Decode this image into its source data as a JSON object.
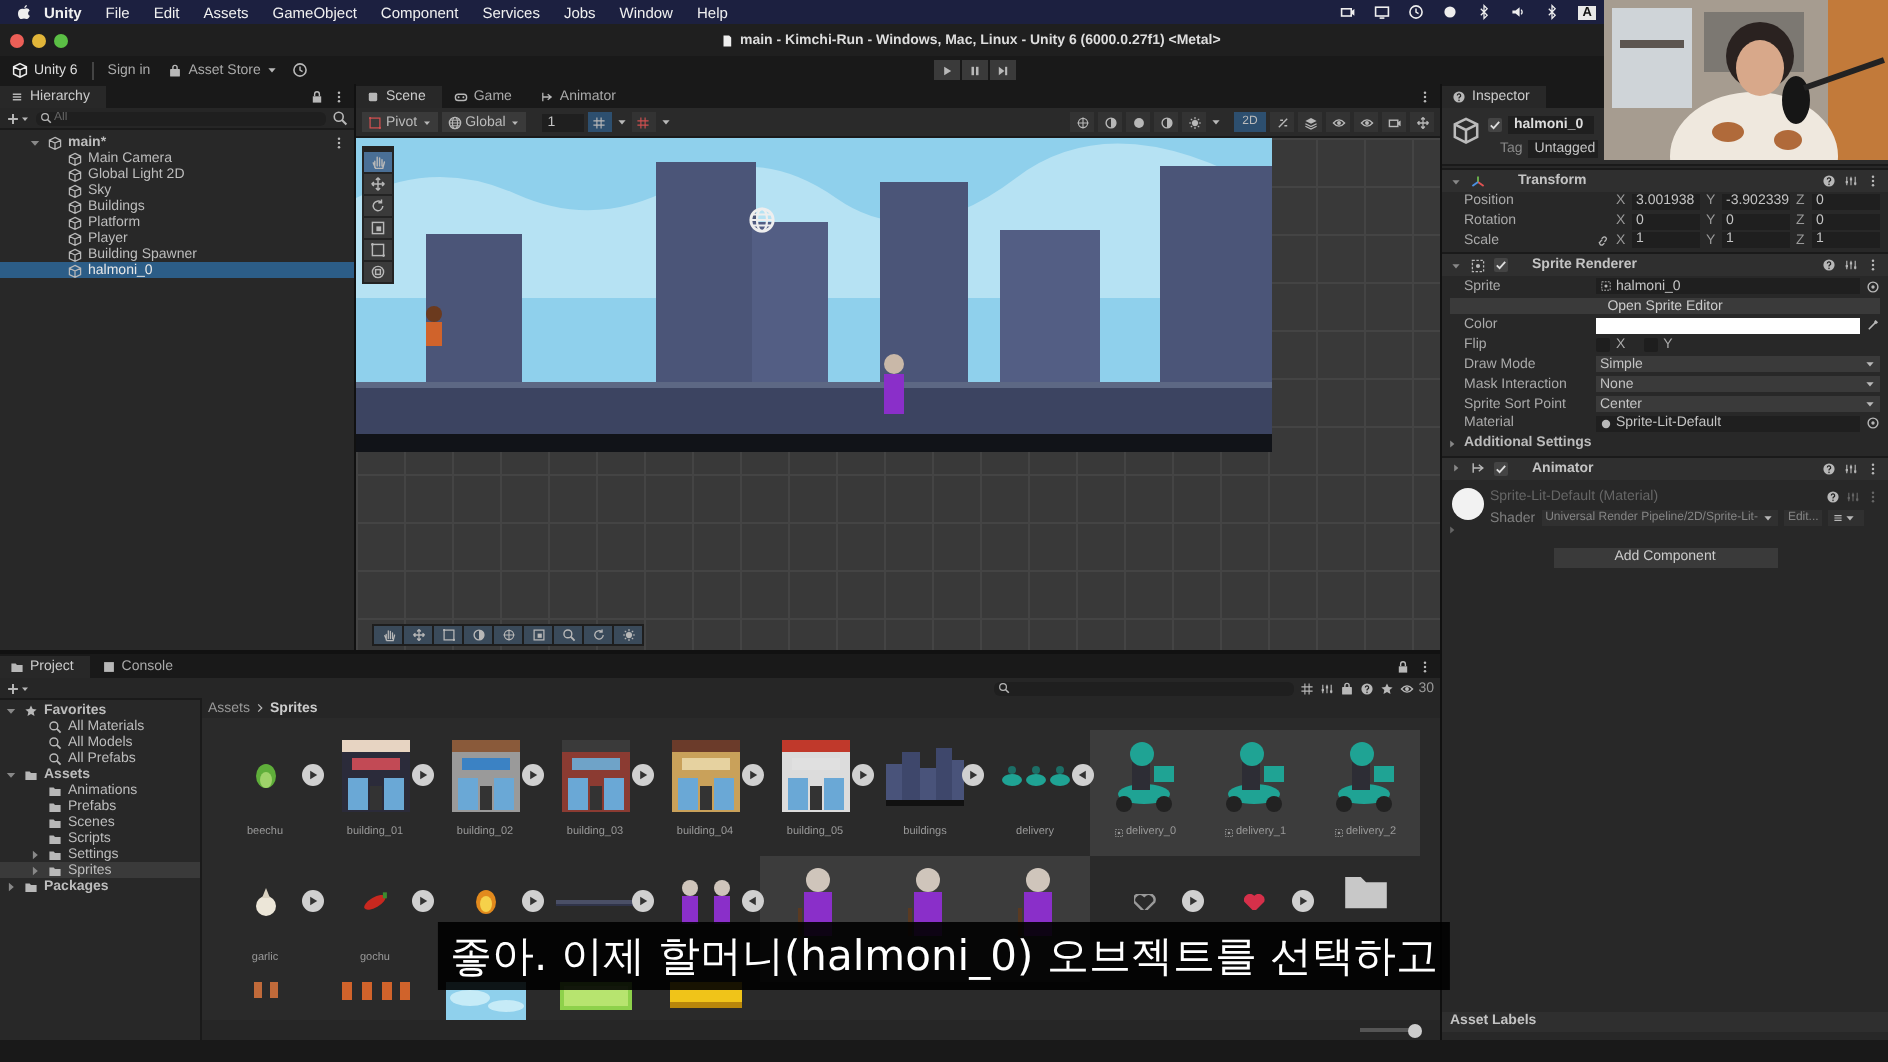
{
  "menu_bar": {
    "app": "Unity",
    "items": [
      "File",
      "Edit",
      "Assets",
      "GameObject",
      "Component",
      "Services",
      "Jobs",
      "Window",
      "Help"
    ],
    "input_source": "A"
  },
  "window": {
    "title": "main - Kimchi-Run - Windows, Mac, Linux - Unity 6 (6000.0.27f1) <Metal>"
  },
  "toolbar": {
    "account": "Unity 6",
    "sign_in": "Sign in",
    "store": "Asset Store"
  },
  "hierarchy": {
    "title": "Hierarchy",
    "search": {
      "placeholder": "All"
    },
    "tree": [
      {
        "label": "main*",
        "expanded": true,
        "selected": false,
        "children": [
          {
            "label": "Main Camera",
            "selected": false
          },
          {
            "label": "Global Light 2D",
            "selected": false
          },
          {
            "label": "Sky",
            "selected": false
          },
          {
            "label": "Buildings",
            "selected": false
          },
          {
            "label": "Platform",
            "selected": false
          },
          {
            "label": "Player",
            "selected": false
          },
          {
            "label": "Building Spawner",
            "selected": false
          },
          {
            "label": "halmoni_0",
            "selected": true
          }
        ]
      }
    ]
  },
  "scene_tabs": [
    {
      "label": "Scene",
      "kind": "scene",
      "selected": true
    },
    {
      "label": "Game",
      "kind": "game",
      "selected": false
    },
    {
      "label": "Animator",
      "kind": "animator",
      "selected": false
    }
  ],
  "scene_toolbar": {
    "pivot": "Pivot",
    "space": "Global",
    "snap_value": "1",
    "mode_2d": {
      "label": "2D",
      "on": true
    }
  },
  "scene_tools": [
    {
      "kind": "hand",
      "selected": true
    },
    {
      "kind": "move",
      "selected": false
    },
    {
      "kind": "rotate",
      "selected": false
    },
    {
      "kind": "scale",
      "selected": false
    },
    {
      "kind": "rect",
      "selected": false
    },
    {
      "kind": "transform",
      "selected": false
    }
  ],
  "inspector": {
    "tab": "Inspector",
    "object": {
      "active": true,
      "name": "halmoni_0",
      "tag_label": "Tag",
      "tag": "Untagged"
    },
    "components": [
      {
        "kind": "transform",
        "title": "Transform",
        "expanded": true,
        "rows": [
          {
            "kind": "vector",
            "label": "Position",
            "values": [
              {
                "axis": "X",
                "value": "3.001938"
              },
              {
                "axis": "Y",
                "value": "-3.902339"
              },
              {
                "axis": "Z",
                "value": "0"
              }
            ]
          },
          {
            "kind": "vector",
            "label": "Rotation",
            "values": [
              {
                "axis": "X",
                "value": "0"
              },
              {
                "axis": "Y",
                "value": "0"
              },
              {
                "axis": "Z",
                "value": "0"
              }
            ]
          },
          {
            "kind": "scale",
            "label": "Scale",
            "values": [
              {
                "axis": "X",
                "value": "1"
              },
              {
                "axis": "Y",
                "value": "1"
              },
              {
                "axis": "Z",
                "value": "1"
              }
            ]
          }
        ]
      },
      {
        "kind": "sprite_renderer",
        "title": "Sprite Renderer",
        "enabled": true,
        "expanded": true,
        "fields": [
          {
            "kind": "sprite_object",
            "label": "Sprite",
            "value": "halmoni_0"
          },
          {
            "kind": "button",
            "label": "Open Sprite Editor"
          },
          {
            "kind": "color",
            "label": "Color",
            "color": "#ffffff"
          },
          {
            "kind": "flags",
            "label": "Flip",
            "options": [
              {
                "label": "X",
                "checked": false
              },
              {
                "label": "Y",
                "checked": false
              }
            ]
          },
          {
            "kind": "dropdown",
            "label": "Draw Mode",
            "value": "Simple"
          },
          {
            "kind": "dropdown",
            "label": "Mask Interaction",
            "value": "None"
          },
          {
            "kind": "dropdown",
            "label": "Sprite Sort Point",
            "value": "Center"
          },
          {
            "kind": "material_object",
            "label": "Material",
            "value": "Sprite-Lit-Default"
          },
          {
            "kind": "foldout",
            "label": "Additional Settings",
            "expanded": false
          }
        ]
      },
      {
        "kind": "animator",
        "title": "Animator",
        "enabled": true,
        "expanded": false
      }
    ],
    "material": {
      "title": "Sprite-Lit-Default (Material)",
      "shader_label": "Shader",
      "shader": "Universal Render Pipeline/2D/Sprite-Lit-",
      "edit": "Edit..."
    },
    "add_component": "Add Component",
    "asset_labels": "Asset Labels"
  },
  "project": {
    "tabs": [
      {
        "label": "Project",
        "kind": "project",
        "selected": true
      },
      {
        "label": "Console",
        "kind": "console",
        "selected": false
      }
    ],
    "count": "30",
    "tree": [
      {
        "label": "Favorites",
        "kind": "favorites",
        "expanded": true,
        "selected": false,
        "children": [
          {
            "label": "All Materials",
            "kind": "search",
            "selected": false
          },
          {
            "label": "All Models",
            "kind": "search",
            "selected": false
          },
          {
            "label": "All Prefabs",
            "kind": "search",
            "selected": false
          }
        ]
      },
      {
        "label": "Assets",
        "kind": "folder",
        "expanded": true,
        "selected": false,
        "children": [
          {
            "label": "Animations",
            "kind": "folder",
            "selected": false
          },
          {
            "label": "Prefabs",
            "kind": "folder",
            "selected": false
          },
          {
            "label": "Scenes",
            "kind": "folder",
            "selected": false
          },
          {
            "label": "Scripts",
            "kind": "folder",
            "selected": false
          },
          {
            "label": "Settings",
            "kind": "folder",
            "expanded": false,
            "selected": false
          },
          {
            "label": "Sprites",
            "kind": "folder",
            "expanded": false,
            "selected": true
          }
        ]
      },
      {
        "label": "Packages",
        "kind": "folder",
        "expanded": false,
        "selected": false
      }
    ],
    "breadcrumb": [
      "Assets",
      "Sprites"
    ],
    "assets": [
      {
        "kind": "sheet",
        "label": "beechu",
        "expanded": false
      },
      {
        "kind": "sheet",
        "label": "building_01",
        "expanded": false
      },
      {
        "kind": "sheet",
        "label": "building_02",
        "expanded": false
      },
      {
        "kind": "sheet",
        "label": "building_03",
        "expanded": false
      },
      {
        "kind": "sheet",
        "label": "building_04",
        "expanded": false
      },
      {
        "kind": "sheet",
        "label": "building_05",
        "expanded": false
      },
      {
        "kind": "sheet",
        "label": "buildings",
        "expanded": false
      },
      {
        "kind": "sheet",
        "label": "delivery",
        "expanded": true
      },
      {
        "kind": "frame",
        "label": "delivery_0"
      },
      {
        "kind": "frame",
        "label": "delivery_1"
      },
      {
        "kind": "frame",
        "label": "delivery_2"
      },
      {
        "kind": "sheet",
        "label": "garlic",
        "expanded": false
      },
      {
        "kind": "sheet",
        "label": "gochu",
        "expanded": false
      },
      {
        "kind": "sheet",
        "expanded": false
      },
      {
        "kind": "sheet",
        "expanded": false
      },
      {
        "kind": "sheet",
        "expanded": true
      },
      {
        "kind": "frame"
      },
      {
        "kind": "frame"
      },
      {
        "kind": "frame"
      },
      {
        "kind": "sheet",
        "expanded": false
      },
      {
        "kind": "sheet",
        "expanded": false
      },
      {
        "kind": "folder"
      },
      {
        "kind": "sheet"
      },
      {
        "kind": "sheet"
      },
      {
        "kind": "sheet"
      },
      {
        "kind": "sheet"
      },
      {
        "kind": "sheet"
      }
    ],
    "thumb_size": {
      "level": 0.9
    }
  },
  "subtitle": "좋아. 이제 할머니(halmoni_0) 오브젝트를 선택하고"
}
